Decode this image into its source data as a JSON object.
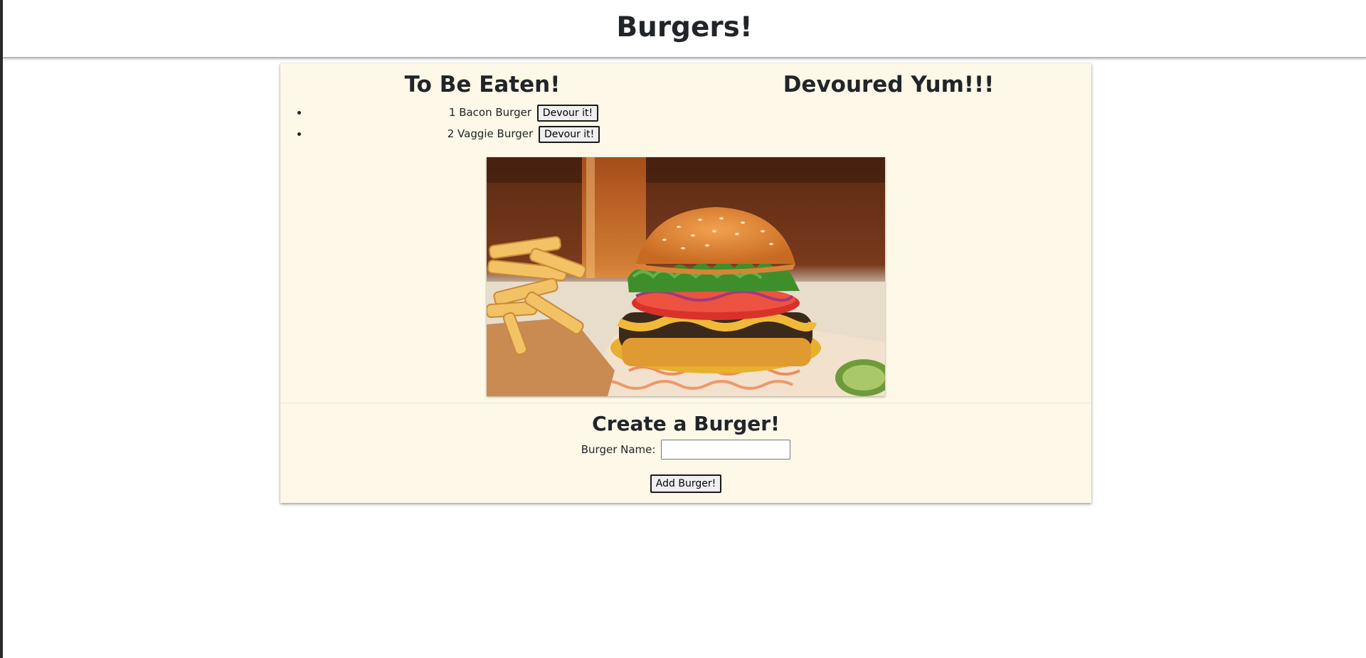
{
  "header": {
    "title": "Burgers!"
  },
  "to_be_eaten": {
    "heading": "To Be Eaten!",
    "items": [
      {
        "id": "1",
        "name": "Bacon Burger",
        "button_label": "Devour it!"
      },
      {
        "id": "2",
        "name": "Vaggie Burger",
        "button_label": "Devour it!"
      }
    ]
  },
  "devoured": {
    "heading": "Devoured Yum!!!"
  },
  "image": {
    "subject": "burger-photo"
  },
  "create": {
    "heading": "Create a Burger!",
    "name_label": "Burger Name:",
    "name_value": "",
    "name_placeholder": "",
    "submit_label": "Add Burger!"
  }
}
